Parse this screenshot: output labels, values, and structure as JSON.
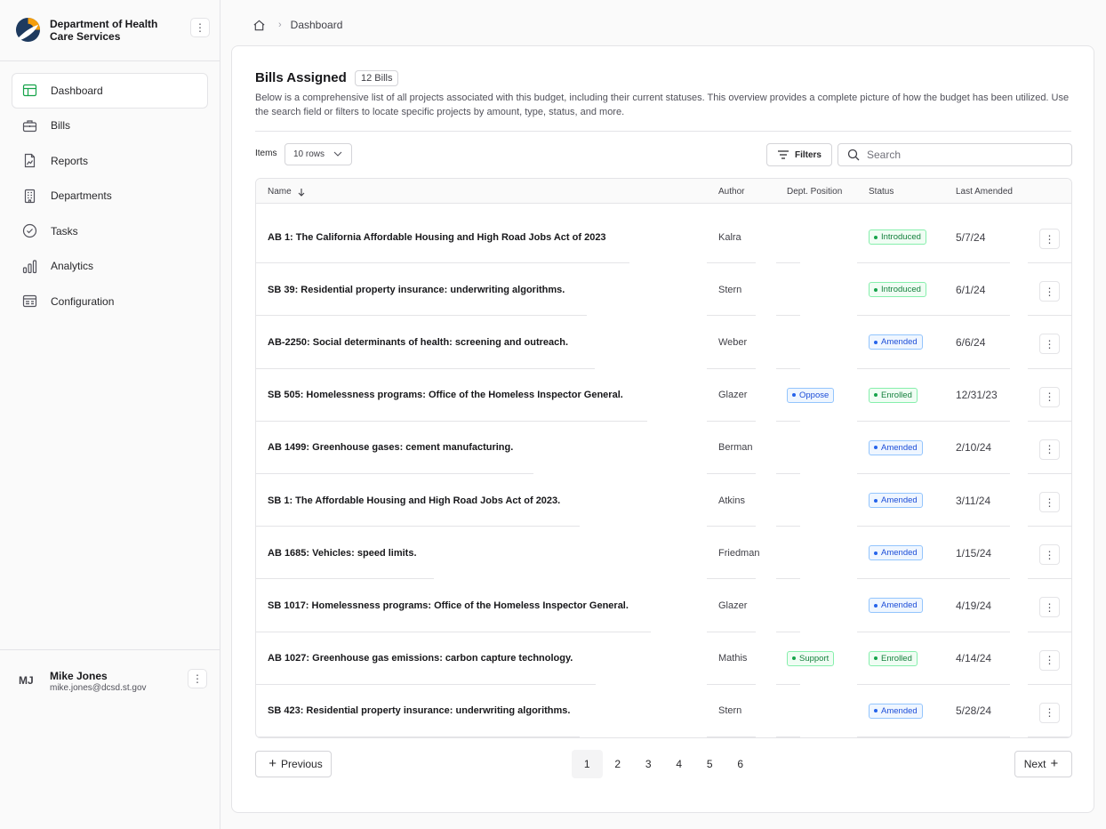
{
  "org": {
    "name": "Department of Health Care Services"
  },
  "nav": [
    {
      "label": "Dashboard",
      "icon": "layout-icon",
      "active": true
    },
    {
      "label": "Bills",
      "icon": "briefcase-icon"
    },
    {
      "label": "Reports",
      "icon": "file-chart-icon"
    },
    {
      "label": "Departments",
      "icon": "building-icon"
    },
    {
      "label": "Tasks",
      "icon": "check-circle-icon"
    },
    {
      "label": "Analytics",
      "icon": "bar-chart-icon"
    },
    {
      "label": "Configuration",
      "icon": "settings-panel-icon"
    }
  ],
  "user": {
    "initials": "MJ",
    "name": "Mike Jones",
    "email": "mike.jones@dcsd.st.gov"
  },
  "breadcrumb": {
    "current": "Dashboard"
  },
  "main": {
    "title": "Bills Assigned",
    "count": "12 Bills",
    "description": "Below is a comprehensive list of all projects associated with this budget, including their current statuses. This overview provides a complete picture of how the budget has been utilized. Use the search field or filters to locate specific projects by amount, type, status, and more.",
    "items_label": "Items",
    "rows_select": "10 rows",
    "filters_label": "Filters",
    "search_placeholder": "Search"
  },
  "table": {
    "columns": {
      "name": "Name",
      "author": "Author",
      "dept": "Dept. Position",
      "status": "Status",
      "amended": "Last Amended"
    },
    "rows": [
      {
        "name": "AB 1: The California Affordable Housing and High Road Jobs Act of 2023",
        "author": "Kalra",
        "dept": "",
        "status": "Introduced",
        "amended": "5/7/24"
      },
      {
        "name": "SB 39: Residential property insurance: underwriting algorithms.",
        "author": "Stern",
        "dept": "",
        "status": "Introduced",
        "amended": "6/1/24"
      },
      {
        "name": "AB-2250: Social determinants of health: screening and outreach.",
        "author": "Weber",
        "dept": "",
        "status": "Amended",
        "amended": "6/6/24"
      },
      {
        "name": "SB 505: Homelessness programs: Office of the Homeless Inspector General.",
        "author": "Glazer",
        "dept": "Oppose",
        "status": "Enrolled",
        "amended": "12/31/23"
      },
      {
        "name": "AB 1499: Greenhouse gases: cement manufacturing.",
        "author": "Berman",
        "dept": "",
        "status": "Amended",
        "amended": "2/10/24"
      },
      {
        "name": "SB 1: The Affordable Housing and High Road Jobs Act of 2023.",
        "author": "Atkins",
        "dept": "",
        "status": "Amended",
        "amended": "3/11/24"
      },
      {
        "name": "AB 1685: Vehicles: speed limits.",
        "author": "Friedman",
        "dept": "",
        "status": "Amended",
        "amended": "1/15/24"
      },
      {
        "name": "SB 1017: Homelessness programs: Office of the Homeless Inspector General.",
        "author": "Glazer",
        "dept": "",
        "status": "Amended",
        "amended": "4/19/24"
      },
      {
        "name": "AB 1027: Greenhouse gas emissions: carbon capture technology.",
        "author": "Mathis",
        "dept": "Support",
        "status": "Enrolled",
        "amended": "4/14/24"
      },
      {
        "name": "SB 423: Residential property insurance: underwriting algorithms.",
        "author": "Stern",
        "dept": "",
        "status": "Amended",
        "amended": "5/28/24"
      }
    ]
  },
  "pagination": {
    "previous": "Previous",
    "next": "Next",
    "pages": [
      "1",
      "2",
      "3",
      "4",
      "5",
      "6"
    ],
    "current": "1"
  },
  "colors": {
    "accent": "#16a34a",
    "status_green": "#15803d",
    "status_blue": "#1d4ed8",
    "oppose_blue": "#1d4ed8"
  }
}
